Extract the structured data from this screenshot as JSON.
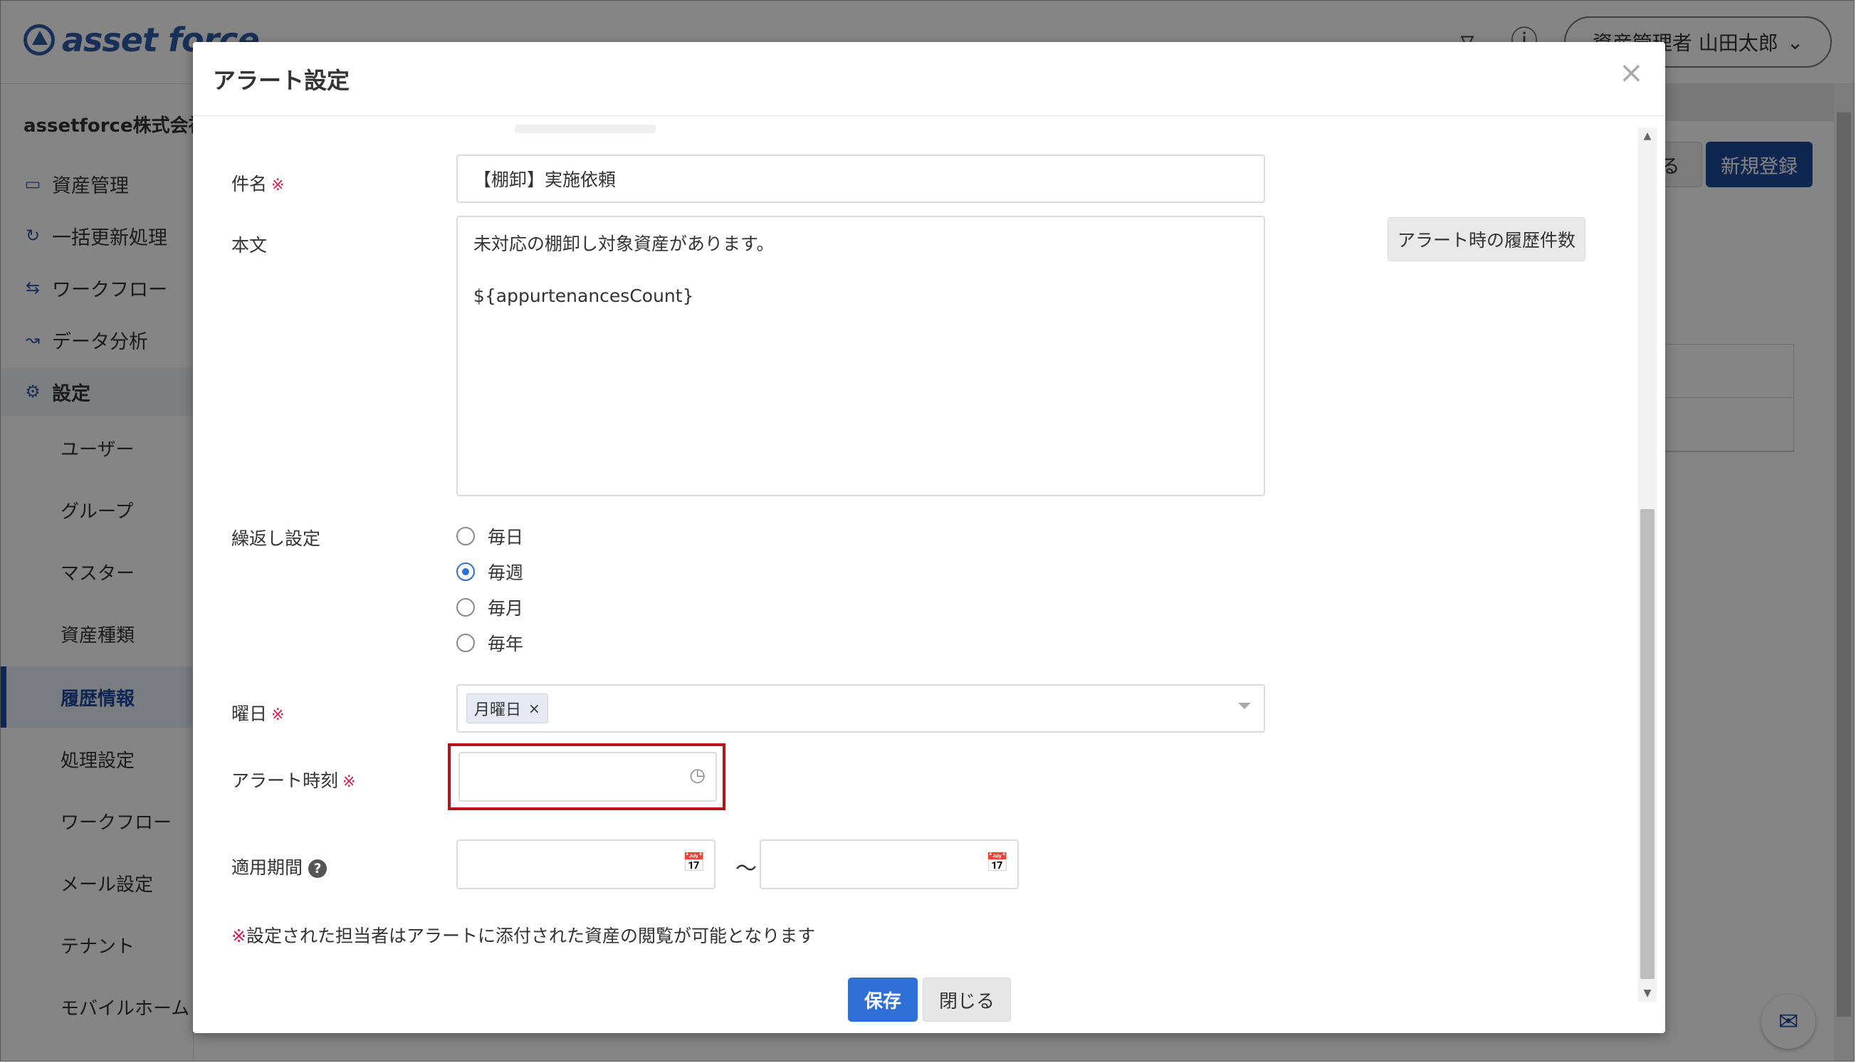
{
  "app": {
    "logo_text": "asset force",
    "user_menu_label": "資産管理者 山田太郎",
    "company": "assetforce株式会社",
    "nav": [
      {
        "label": "資産管理",
        "icon": "cube-icon"
      },
      {
        "label": "一括更新処理",
        "icon": "refresh-icon"
      },
      {
        "label": "ワークフロー",
        "icon": "workflow-icon"
      },
      {
        "label": "データ分析",
        "icon": "analytics-icon"
      },
      {
        "label": "設定",
        "icon": "gear-icon"
      }
    ],
    "settings_sub": [
      {
        "label": "ユーザー"
      },
      {
        "label": "グループ"
      },
      {
        "label": "マスター"
      },
      {
        "label": "資産種類"
      },
      {
        "label": "履歴情報"
      },
      {
        "label": "処理設定"
      },
      {
        "label": "ワークフロー"
      },
      {
        "label": "メール設定"
      },
      {
        "label": "テナント"
      },
      {
        "label": "モバイルホーム"
      }
    ],
    "active_settings_item": "履歴情報",
    "bg_buttons": {
      "close_partial": "る",
      "new_register": "新規登録"
    }
  },
  "modal": {
    "title": "アラート設定",
    "close_glyph": "×",
    "fields": {
      "subject": {
        "label": "件名",
        "required_mark": "※",
        "value": "【棚卸】実施依頼"
      },
      "body": {
        "label": "本文",
        "value": "未対応の棚卸し対象資産があります。\n\n${appurtenancesCount}"
      },
      "history_button": "アラート時の履歴件数",
      "repeat": {
        "label": "繰返し設定",
        "options": [
          "毎日",
          "毎週",
          "毎月",
          "毎年"
        ],
        "selected": "毎週"
      },
      "weekday": {
        "label": "曜日",
        "required_mark": "※",
        "selected_tags": [
          "月曜日"
        ],
        "tag_remove": "×"
      },
      "alert_time": {
        "label": "アラート時刻",
        "required_mark": "※",
        "value": ""
      },
      "period": {
        "label": "適用期間",
        "help_glyph": "?",
        "separator": "〜",
        "start": "",
        "end": ""
      }
    },
    "note": {
      "mark": "※",
      "text": "設定された担当者はアラートに添付された資産の閲覧が可能となります"
    },
    "buttons": {
      "save": "保存",
      "close": "閉じる"
    }
  }
}
